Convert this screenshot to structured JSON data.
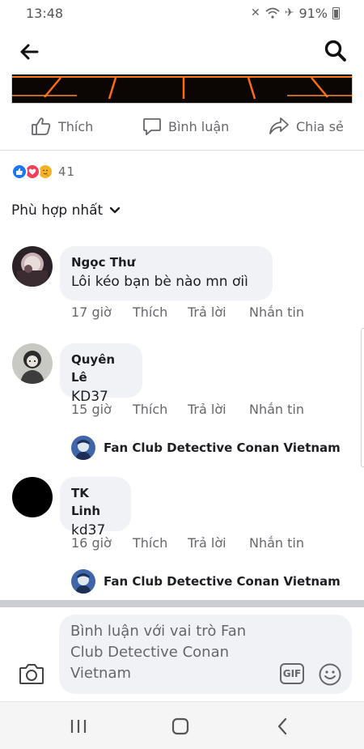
{
  "status": {
    "time": "13:48",
    "battery": "91%"
  },
  "actions": {
    "like": "Thích",
    "comment": "Bình luận",
    "share": "Chia sẻ"
  },
  "reactions": {
    "count": "41"
  },
  "sort": {
    "label": "Phù hợp nhất"
  },
  "comments": [
    {
      "name": "Ngọc Thư",
      "text": "Lôi kéo bạn bè nào mn ơiì",
      "time": "17 giờ",
      "like": "Thích",
      "reply": "Trả lời",
      "message": "Nhắn tin"
    },
    {
      "name": "Quyên Lê",
      "text": "KD37",
      "time": "15 giờ",
      "like": "Thích",
      "reply": "Trả lời",
      "message": "Nhắn tin",
      "page_reply": "Fan Club Detective Conan Vietnam"
    },
    {
      "name": "TK Linh",
      "text": "kd37",
      "time": "16 giờ",
      "like": "Thích",
      "reply": "Trả lời",
      "message": "Nhắn tin",
      "page_reply": "Fan Club Detective Conan Vietnam"
    }
  ],
  "composer": {
    "placeholder": "Bình luận với vai trò Fan Club Detective Conan Vietnam",
    "gif": "GIF"
  },
  "colors": {
    "accent": "#1877f2",
    "love": "#f33e58",
    "care": "#f7b125",
    "bubble": "#f0f2f5",
    "muted": "#65676b"
  },
  "icons": [
    "back-arrow-icon",
    "search-icon",
    "like-icon",
    "comment-icon",
    "share-icon",
    "chevron-down-icon",
    "camera-icon",
    "emoji-icon",
    "recent-apps-icon",
    "home-icon",
    "back-nav-icon"
  ]
}
